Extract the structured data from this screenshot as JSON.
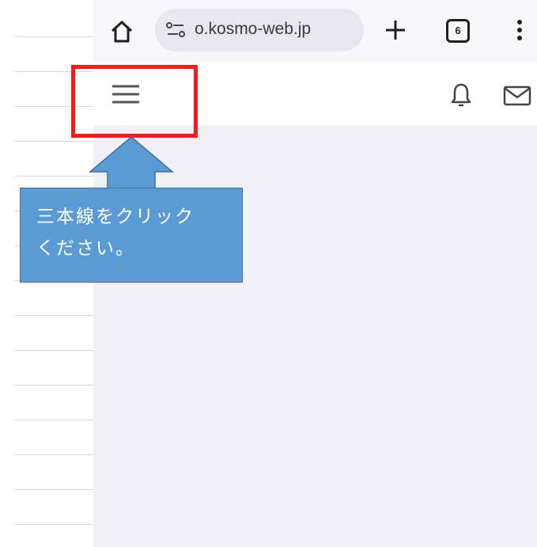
{
  "browser": {
    "url": "o.kosmo-web.jp",
    "tab_count": "6",
    "icons": {
      "home": "home-icon",
      "site_info": "site-settings-icon",
      "new_tab": "plus-icon",
      "tabs": "tab-switcher-icon",
      "menu": "more-vertical-icon"
    }
  },
  "site_header": {
    "icons": {
      "menu": "hamburger-menu-icon",
      "notifications": "bell-icon",
      "messages": "mail-icon"
    }
  },
  "annotation": {
    "callout_lines": [
      "三本線をクリック",
      "ください。"
    ],
    "highlight_color": "#ff1a1a",
    "callout_color": "#5b9bd5"
  }
}
